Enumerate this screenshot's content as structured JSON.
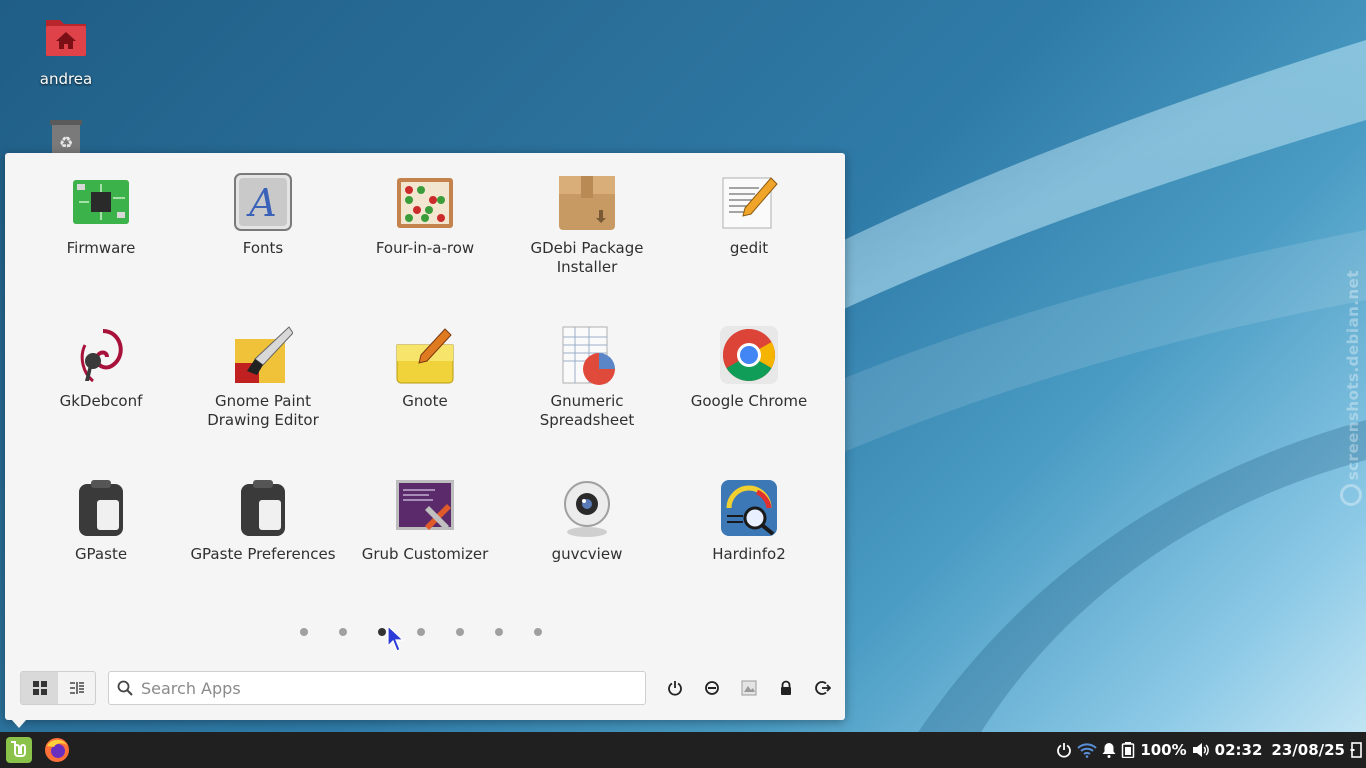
{
  "desktop": {
    "icons": [
      {
        "label": "andrea",
        "icon": "home-folder-icon"
      },
      {
        "label": "",
        "icon": "trash-icon"
      }
    ],
    "watermark": "screenshots.debian.net"
  },
  "menu": {
    "apps": [
      {
        "name": "Firmware",
        "icon": "firmware-icon"
      },
      {
        "name": "Fonts",
        "icon": "fonts-icon"
      },
      {
        "name": "Four-in-a-row",
        "icon": "four-in-a-row-icon"
      },
      {
        "name": "GDebi Package Installer",
        "icon": "package-installer-icon"
      },
      {
        "name": "gedit",
        "icon": "text-editor-icon"
      },
      {
        "name": "GkDebconf",
        "icon": "debian-swirl-icon"
      },
      {
        "name": "Gnome Paint Drawing Editor",
        "icon": "paint-icon"
      },
      {
        "name": "Gnote",
        "icon": "notes-icon"
      },
      {
        "name": "Gnumeric Spreadsheet",
        "icon": "spreadsheet-icon"
      },
      {
        "name": "Google Chrome",
        "icon": "chrome-icon"
      },
      {
        "name": "GPaste",
        "icon": "clipboard-icon"
      },
      {
        "name": "GPaste Preferences",
        "icon": "clipboard-icon"
      },
      {
        "name": "Grub Customizer",
        "icon": "grub-customizer-icon"
      },
      {
        "name": "guvcview",
        "icon": "webcam-icon"
      },
      {
        "name": "Hardinfo2",
        "icon": "system-info-icon"
      }
    ],
    "pager": {
      "pages": 7,
      "current": 3
    },
    "search": {
      "placeholder": "Search Apps",
      "value": ""
    },
    "view_modes": [
      "grid-view-icon",
      "list-view-icon"
    ],
    "system_buttons": [
      "power-icon",
      "suspend-icon",
      "screensaver-icon",
      "lock-icon",
      "logout-icon"
    ]
  },
  "taskbar": {
    "launchers": [
      "mint-menu-icon",
      "firefox-icon"
    ],
    "tray": {
      "battery": "100%",
      "time": "02:32",
      "date": "23/08/25"
    }
  }
}
